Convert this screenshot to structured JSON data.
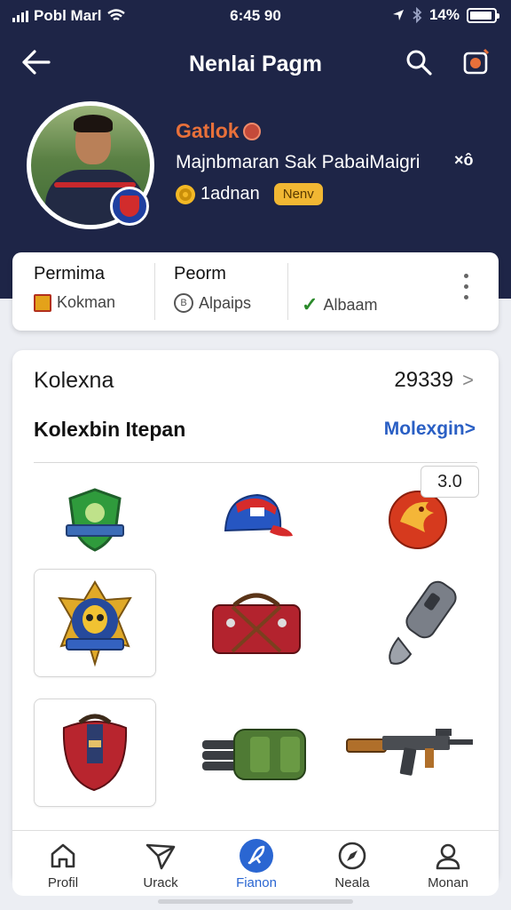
{
  "status_bar": {
    "carrier": "Pobl Marl",
    "time": "6:45 90",
    "battery": "14%"
  },
  "header": {
    "title": "Nenlai Pagm",
    "back_icon": "arrow-left-icon",
    "search_icon": "search-icon",
    "action_icon": "settings-badge-icon"
  },
  "profile": {
    "name": "Gatlok",
    "subtitle": "Majnbmaran Sak PabaiMaigri",
    "close_mark": "×ô",
    "level_label": "1adnan",
    "badge_label": "Nenv"
  },
  "stats": {
    "items": [
      {
        "title": "Permima",
        "value": "Kokman",
        "icon": "coin-icon"
      },
      {
        "title": "Peorm",
        "value": "Alpaips",
        "icon": "circle-b-icon"
      },
      {
        "title": "",
        "value": "Albaam",
        "icon": "check-icon"
      }
    ]
  },
  "collection": {
    "title": "Kolexna",
    "count": "29339",
    "subtitle": "Kolexbin Itepan",
    "link": "Molexgin",
    "quantity": "3.0",
    "items": [
      "shield-emblem",
      "baseball-cap",
      "phoenix-orb",
      "skull-crest-badge",
      "red-duffel-bag",
      "grey-controller",
      "red-backpack",
      "green-gatling-gun",
      "assault-rifle"
    ]
  },
  "nav": {
    "items": [
      {
        "label": "Profil",
        "icon": "home-icon"
      },
      {
        "label": "Urack",
        "icon": "send-icon"
      },
      {
        "label": "Fianon",
        "icon": "rocket-icon"
      },
      {
        "label": "Neala",
        "icon": "compass-icon"
      },
      {
        "label": "Monan",
        "icon": "person-icon"
      }
    ]
  },
  "colors": {
    "header_bg": "#1e2547",
    "accent": "#2a66d2",
    "name": "#e8703a",
    "badge": "#f1b733"
  }
}
